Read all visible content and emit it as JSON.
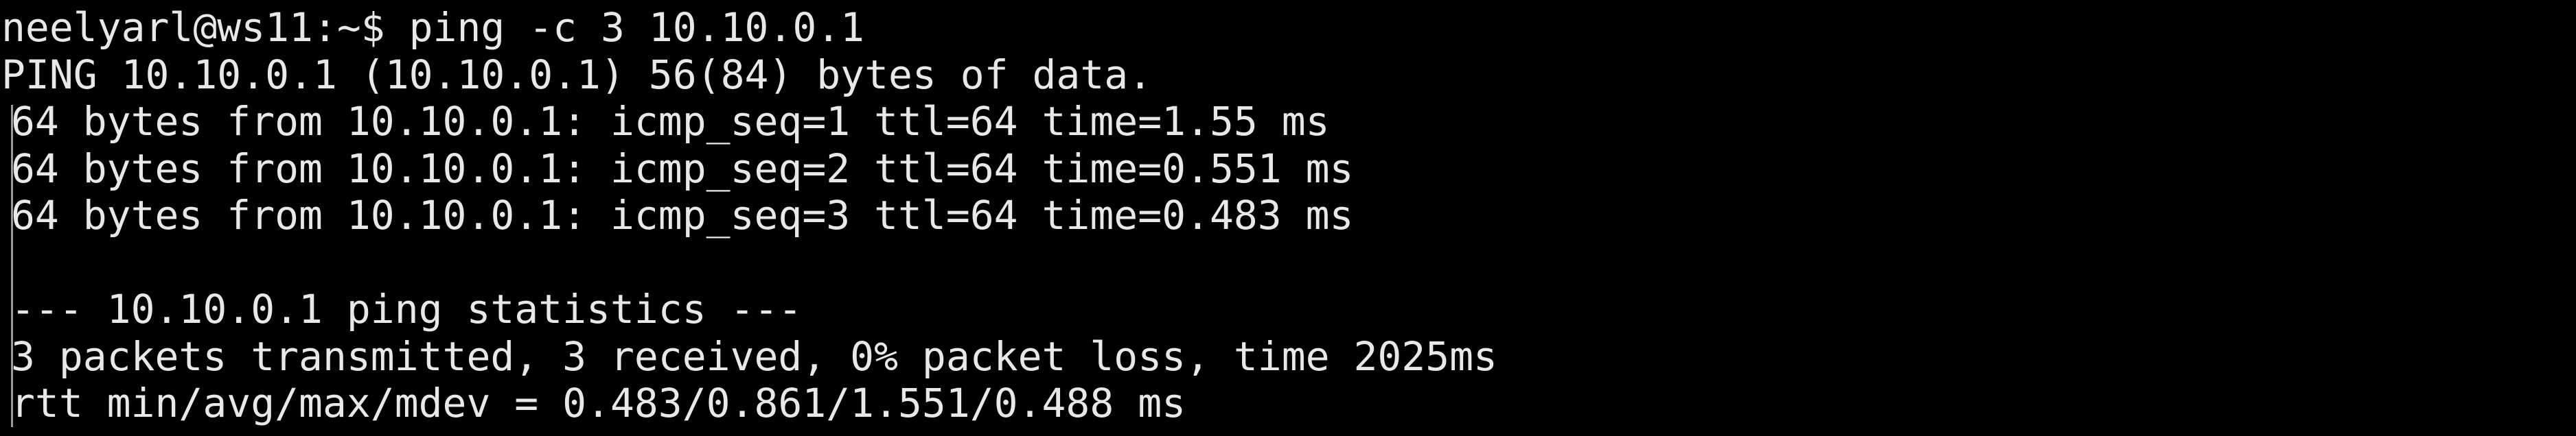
{
  "terminal": {
    "prompt": "neelyarl@ws11:~$ ",
    "command": "ping -c 3 10.10.0.1",
    "header": "PING 10.10.0.1 (10.10.0.1) 56(84) bytes of data.",
    "replies": [
      "64 bytes from 10.10.0.1: icmp_seq=1 ttl=64 time=1.55 ms",
      "64 bytes from 10.10.0.1: icmp_seq=2 ttl=64 time=0.551 ms",
      "64 bytes from 10.10.0.1: icmp_seq=3 ttl=64 time=0.483 ms"
    ],
    "stats_header": "--- 10.10.0.1 ping statistics ---",
    "stats_summary": "3 packets transmitted, 3 received, 0% packet loss, time 2025ms",
    "rtt": "rtt min/avg/max/mdev = 0.483/0.861/1.551/0.488 ms",
    "colors": {
      "background": "#000000",
      "text": "#e8e8e8"
    }
  }
}
